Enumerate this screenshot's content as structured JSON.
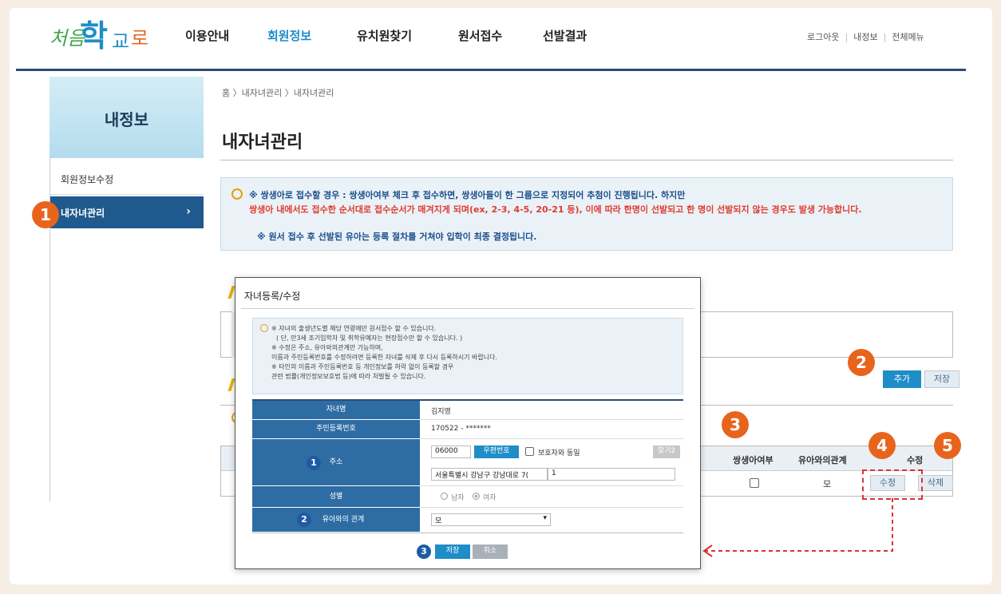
{
  "header": {
    "logo_text": "처음학교로",
    "nav": [
      "이용안내",
      "회원정보",
      "유치원찾기",
      "원서접수",
      "선발결과"
    ],
    "active_nav": "회원정보",
    "util": [
      "로그아웃",
      "내정보",
      "전체메뉴"
    ]
  },
  "sidebar": {
    "title": "내정보",
    "items": [
      {
        "label": "회원정보수정"
      },
      {
        "label": "내자녀관리",
        "chevron": "›"
      }
    ]
  },
  "breadcrumb": "홈 〉내자녀관리 〉내자녀관리",
  "page_title": "내자녀관리",
  "notice": {
    "line1": "※ 쌍생아로 접수할 경우 : 쌍생아여부 체크 후 접수하면, 쌍생아들이 한 그룹으로 지정되어 추첨이 진행됩니다. 하지만",
    "line2": "쌍생아 내에서도 접수한 순서대로 접수순서가 매겨지게 되며(ex, 2-3, 4-5, 20-21 등), 이에 따라 한명이 선발되고 한 명이 선발되지 않는 경우도 발생 가능합니다.",
    "line3": "※ 원서 접수 후 선발된 유아는 등록 절차를 거쳐야 입학이 최종 결정됩니다.",
    "colors": {
      "accent": "#e8a000",
      "warning": "#e03b2e",
      "emphasis": "#1b4e8a"
    }
  },
  "actions": {
    "add": "추가",
    "save": "저장"
  },
  "child_table": {
    "headers": [
      "쌍생아여부",
      "유아와의관계",
      "수정"
    ],
    "row": {
      "relation": "모",
      "edit": "수정",
      "delete": "삭제"
    }
  },
  "markers": [
    "1",
    "2",
    "3",
    "4",
    "5"
  ],
  "modal": {
    "title": "자녀등록/수정",
    "notice_lines": [
      "※ 자녀의 출생년도별 해당 연령에만 원서접수 할 수 있습니다.",
      "( 단, 만3세 조기입학자 및 취학유예자는 현장접수만 할 수 있습니다. )",
      "※ 수정은 주소, 유아와의관계만 가능하며,",
      "이름과 주민등록번호를 수정하려면 등록한 자녀를 삭제 후 다시 등록하시기 바랍니다.",
      "※ 타인의 이름과 주민등록번호 등 개인정보를 허락 없이 등록할 경우",
      "관련 법률(개인정보보호법 등)에 따라 처벌될 수 있습니다."
    ],
    "labels": {
      "name": "자녀명",
      "rrn": "주민등록번호",
      "address": "주소",
      "gender": "성별",
      "relation": "유아와의 관계"
    },
    "values": {
      "name": "김지영",
      "rrn": "170522 - *******",
      "zipcode": "06000",
      "zip_button": "우편번호",
      "same_as_guardian": "보호자와 동일",
      "find_button": "찾기2",
      "address1": "서울특별시 강남구 강남대로 7(",
      "address2": "1",
      "gender_male": "남자",
      "gender_female": "여자",
      "relation": "모"
    },
    "buttons": {
      "save": "저장",
      "cancel": "취소"
    },
    "markers": [
      "1",
      "2",
      "3"
    ]
  }
}
